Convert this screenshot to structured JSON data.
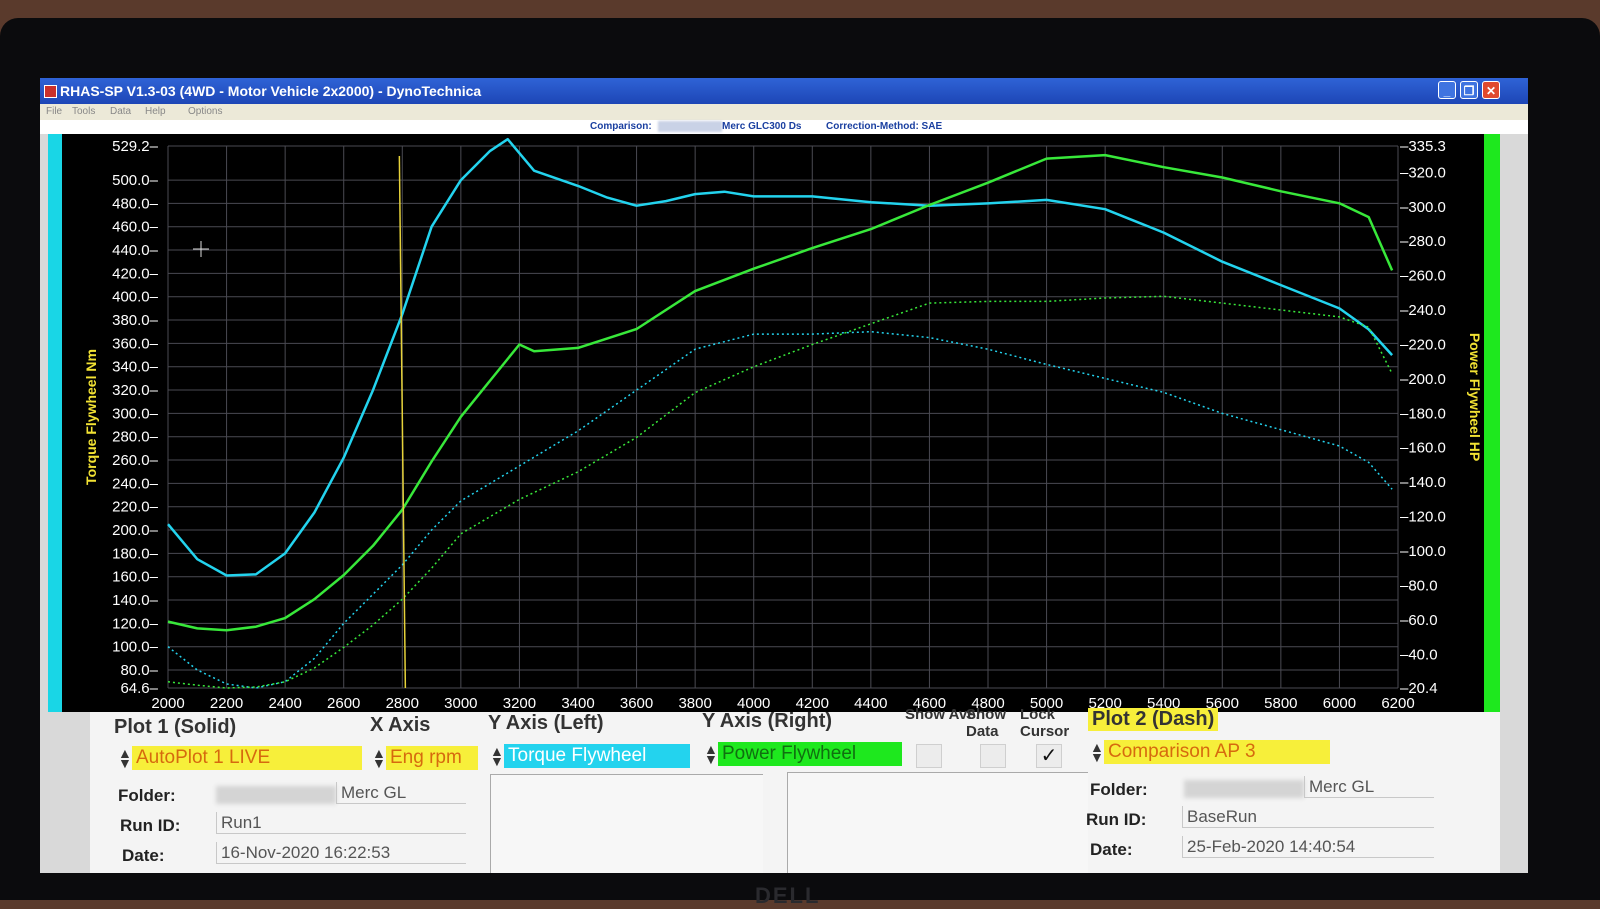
{
  "window": {
    "title": "RHAS-SP V1.3-03  (4WD - Motor Vehicle 2x2000) - DynoTechnica"
  },
  "menubar": {
    "items": [
      "File",
      "Tools",
      "Data",
      "Help",
      "Options"
    ]
  },
  "infobar": {
    "comparison_label": "Comparison:",
    "comparison_value": "Merc GLC300 Ds",
    "correction_label": "Correction-Method: SAE"
  },
  "colors": {
    "torque": "#23d3ee",
    "power": "#38e83a",
    "cursor_line": "#e6d23a",
    "axis_title": "#f2e233",
    "plot1_select": "#f7ef3a",
    "xaxis_select": "#f7ef3a",
    "yleft_select": "#23d3ee",
    "yright_select": "#1ee81e",
    "plot2_select": "#f7ef3a"
  },
  "chart_data": {
    "type": "line",
    "x_label": "Eng rpm",
    "y_left_label": "Torque Flywheel Nm",
    "y_right_label": "Power Flywheel HP",
    "xlim": [
      2000,
      6200
    ],
    "ylim_left": [
      64.6,
      529.2
    ],
    "ylim_right": [
      20.4,
      335.3
    ],
    "x_ticks": [
      2000,
      2200,
      2400,
      2600,
      2800,
      3000,
      3200,
      3400,
      3600,
      3800,
      4000,
      4200,
      4400,
      4600,
      4800,
      5000,
      5200,
      5400,
      5600,
      5800,
      6000,
      6200
    ],
    "y_left_ticks": [
      "529.2",
      "500.0",
      "480.0",
      "460.0",
      "440.0",
      "420.0",
      "400.0",
      "380.0",
      "360.0",
      "340.0",
      "320.0",
      "300.0",
      "280.0",
      "260.0",
      "240.0",
      "220.0",
      "200.0",
      "180.0",
      "160.0",
      "140.0",
      "120.0",
      "100.0",
      "80.0",
      "64.6"
    ],
    "y_right_ticks": [
      "335.3",
      "320.0",
      "300.0",
      "280.0",
      "260.0",
      "240.0",
      "220.0",
      "200.0",
      "180.0",
      "160.0",
      "140.0",
      "120.0",
      "100.0",
      "80.0",
      "60.0",
      "40.0",
      "20.4"
    ],
    "grid": true,
    "cursor_rpm": 2790,
    "series": [
      {
        "name": "Torque Flywheel",
        "plot": "Plot 1 (Solid)",
        "axis": "left",
        "x": [
          2000,
          2100,
          2200,
          2300,
          2400,
          2500,
          2600,
          2700,
          2800,
          2900,
          3000,
          3100,
          3160,
          3250,
          3400,
          3500,
          3600,
          3700,
          3800,
          3900,
          4000,
          4200,
          4400,
          4600,
          4800,
          5000,
          5200,
          5400,
          5600,
          5800,
          6000,
          6100,
          6180
        ],
        "values": [
          205,
          175,
          161,
          162,
          180,
          215,
          262,
          320,
          385,
          460,
          500,
          525,
          535,
          508,
          495,
          485,
          478,
          482,
          488,
          490,
          486,
          486,
          481,
          478,
          480,
          483,
          475,
          455,
          430,
          410,
          390,
          372,
          350
        ]
      },
      {
        "name": "Power Flywheel",
        "plot": "Plot 1 (Solid)",
        "axis": "right",
        "x": [
          2000,
          2100,
          2200,
          2300,
          2400,
          2500,
          2600,
          2700,
          2800,
          2900,
          3000,
          3100,
          3200,
          3250,
          3400,
          3600,
          3800,
          4000,
          4200,
          4400,
          4600,
          4800,
          5000,
          5200,
          5400,
          5600,
          5800,
          6000,
          6100,
          6180
        ],
        "values": [
          59,
          55,
          54,
          56,
          61,
          72,
          86,
          103,
          124,
          152,
          178,
          199,
          220,
          216,
          218,
          229,
          251,
          264,
          276,
          287,
          301,
          314,
          328,
          330,
          323,
          317,
          309,
          302,
          294,
          263
        ]
      },
      {
        "name": "Torque Flywheel",
        "plot": "Plot 2 (Dash)",
        "axis": "left",
        "x": [
          2000,
          2100,
          2200,
          2300,
          2400,
          2500,
          2600,
          2700,
          2800,
          2900,
          3000,
          3200,
          3400,
          3600,
          3800,
          4000,
          4200,
          4400,
          4600,
          4800,
          5000,
          5200,
          5400,
          5600,
          5800,
          6000,
          6100,
          6180
        ],
        "values": [
          100,
          80,
          68,
          64.6,
          70,
          90,
          120,
          145,
          170,
          200,
          225,
          255,
          285,
          320,
          355,
          368,
          368,
          370,
          365,
          355,
          342,
          330,
          318,
          300,
          286,
          272,
          258,
          235
        ]
      },
      {
        "name": "Power Flywheel",
        "plot": "Plot 2 (Dash)",
        "axis": "right",
        "x": [
          2000,
          2100,
          2200,
          2300,
          2400,
          2500,
          2600,
          2700,
          2800,
          2900,
          3000,
          3200,
          3400,
          3600,
          3800,
          4000,
          4200,
          4400,
          4600,
          4800,
          5000,
          5200,
          5400,
          5600,
          5800,
          6000,
          6100,
          6180
        ],
        "values": [
          24,
          22,
          20.4,
          21,
          24,
          32,
          44,
          57,
          72,
          90,
          110,
          130,
          146,
          166,
          192,
          207,
          220,
          232,
          244,
          245,
          245,
          247,
          248,
          244,
          240,
          236,
          230,
          203
        ]
      }
    ]
  },
  "lower": {
    "plot1_title": "Plot 1 (Solid)",
    "x_axis_title": "X Axis",
    "y_left_title": "Y Axis (Left)",
    "y_right_title": "Y Axis (Right)",
    "show_ave": "Show Ave.",
    "show_data": "Show Data",
    "lock_cursor": "Lock Cursor",
    "plot2_title": "Plot 2 (Dash)",
    "plot1_select": "AutoPlot 1 LIVE",
    "xaxis_select": "Eng rpm",
    "yleft_select": "Torque Flywheel",
    "yright_select": "Power Flywheel",
    "plot2_select": "Comparison AP 3",
    "show_ave_checked": false,
    "show_data_checked": false,
    "lock_cursor_check": "✓",
    "plot1": {
      "folder_label": "Folder:",
      "folder_value": "Merc GL",
      "runid_label": "Run ID:",
      "runid_value": "Run1",
      "date_label": "Date:",
      "date_value": "16-Nov-2020  16:22:53"
    },
    "plot2": {
      "folder_label": "Folder:",
      "folder_value": "Merc GL",
      "runid_label": "Run ID:",
      "runid_value": "BaseRun",
      "date_label": "Date:",
      "date_value": "25-Feb-2020  14:40:54"
    }
  },
  "bezel_logo": "DELL"
}
